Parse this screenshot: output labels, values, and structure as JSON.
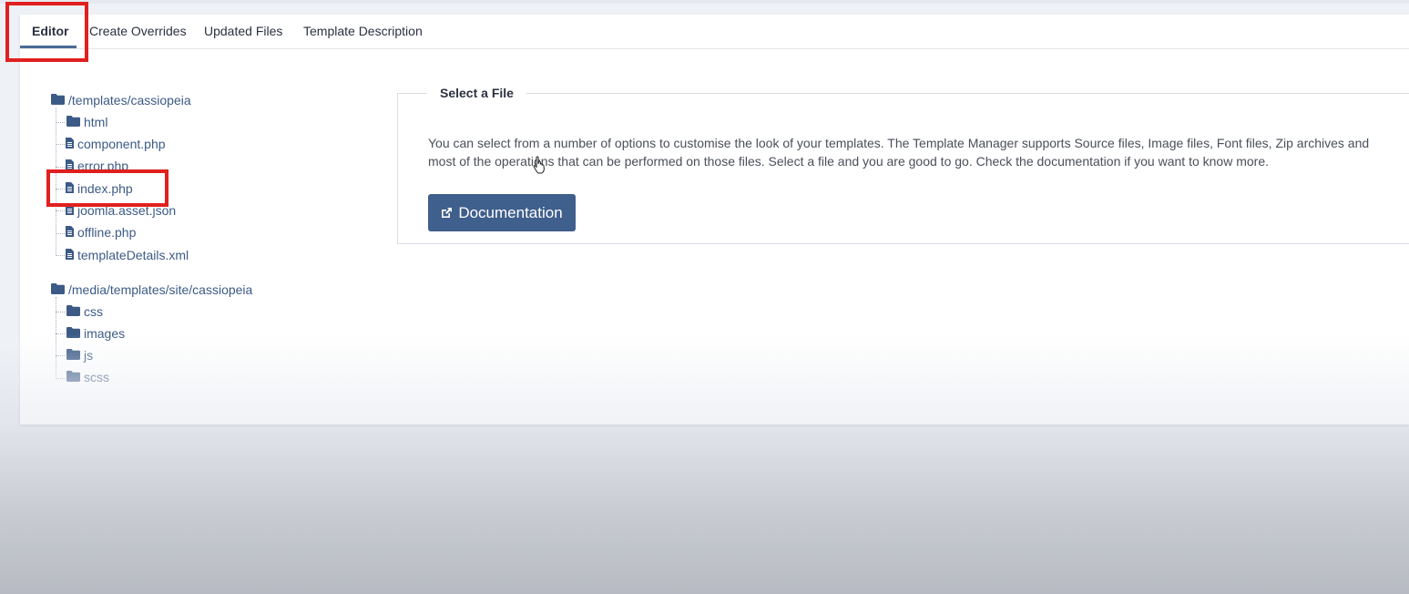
{
  "tabs": [
    {
      "label": "Editor",
      "active": true
    },
    {
      "label": "Create Overrides",
      "active": false
    },
    {
      "label": "Updated Files",
      "active": false
    },
    {
      "label": "Template Description",
      "active": false
    }
  ],
  "tree": {
    "groups": [
      {
        "label": "/templates/cassiopeia",
        "icon": "folder-icon",
        "children": [
          {
            "label": "html",
            "icon": "folder-icon"
          },
          {
            "label": "component.php",
            "icon": "file-icon"
          },
          {
            "label": "error.php",
            "icon": "file-icon"
          },
          {
            "label": "index.php",
            "icon": "file-icon"
          },
          {
            "label": "joomla.asset.json",
            "icon": "file-icon"
          },
          {
            "label": "offline.php",
            "icon": "file-icon"
          },
          {
            "label": "templateDetails.xml",
            "icon": "file-icon"
          }
        ]
      },
      {
        "label": "/media/templates/site/cassiopeia",
        "icon": "folder-icon",
        "children": [
          {
            "label": "css",
            "icon": "folder-icon"
          },
          {
            "label": "images",
            "icon": "folder-icon"
          },
          {
            "label": "js",
            "icon": "folder-icon"
          },
          {
            "label": "scss",
            "icon": "folder-icon"
          }
        ]
      }
    ]
  },
  "select_file": {
    "legend": "Select a File",
    "description": "You can select from a number of options to customise the look of your templates. The Template Manager supports Source files, Image files, Font files, Zip archives and most of the operations that can be performed on those files. Select a file and you are good to go. Check the documentation if you want to know more.",
    "button_label": "Documentation",
    "button_icon": "external-link-icon"
  },
  "colors": {
    "accent": "#3f5f8c",
    "link": "#3c5a86",
    "highlight_box": "#e0201f"
  }
}
